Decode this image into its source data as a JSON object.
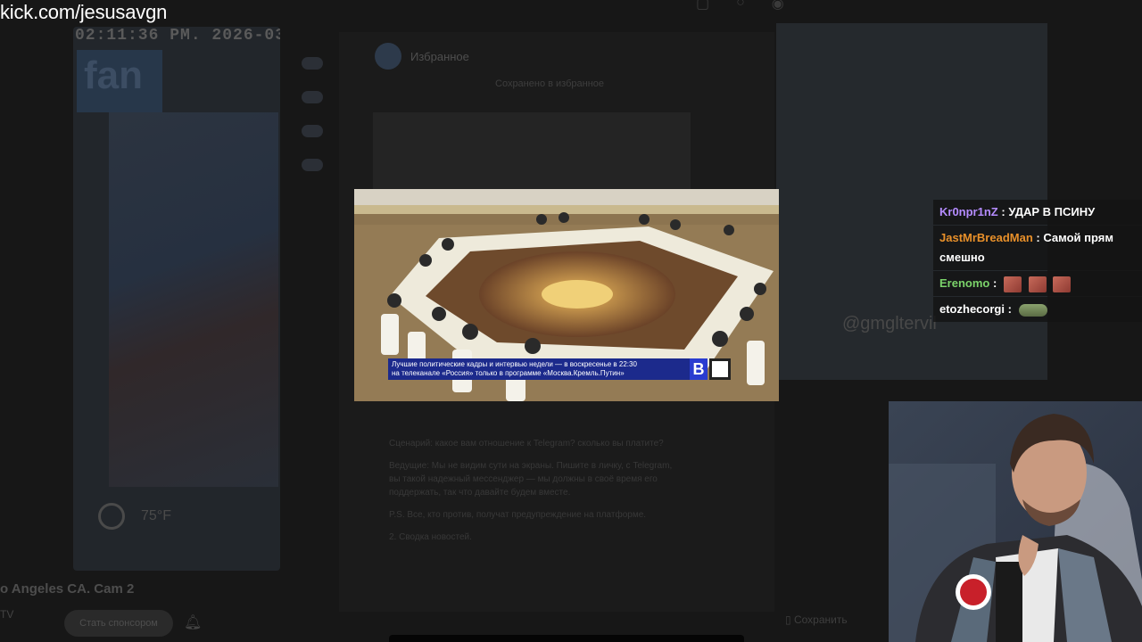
{
  "stream": {
    "channel_url": "kick.com/jesusavgn"
  },
  "background": {
    "clock": "02:11:36 PM.  2026-03-",
    "logo_text": "fan",
    "temperature": "75°F",
    "cam_title": "o Angeles CA. Cam 2",
    "cam_channel": "TV",
    "subscribe_label": "Стать спонсором",
    "messenger_title": "Избранное",
    "pinned_label": "Сохранено в избранное",
    "save_label": "Сохранить",
    "watermark": "@gmgltervil",
    "article_paragraphs": [
      "Сценарий: какое вам отношение к Telegram? сколько вы платите?",
      "Ведущие: Мы не видим сути на экраны. Пишите в личку, с Telegram, вы такой надежный мессенджер — мы должны в своё время его поддержать, так что давайте будем вместе.",
      "P.S. Все, кто против, получат предупреждение на платформе.",
      "2. Сводка новостей."
    ]
  },
  "video": {
    "ticker_line1": "Лучшие политические кадры и интервью недели — в воскресенье в 22:30",
    "ticker_line2": "на телеканале «Россия» только в программе «Москва.Кремль.Путин»",
    "channel_logo": "В",
    "colors": {
      "ticker": "#1c2a8c",
      "table": "#f1ecd8",
      "floor": "#7a5a3a"
    }
  },
  "chat": {
    "messages": [
      {
        "user": "Kr0npr1nZ",
        "user_color": "#b58cff",
        "text": "УДАР В ПСИНУ",
        "emotes": []
      },
      {
        "user": "JastMrBreadMan",
        "user_color": "#e8902a",
        "text": "Самой прям смешно",
        "emotes": []
      },
      {
        "user": "Erenomo",
        "user_color": "#7bd36a",
        "text": "",
        "emotes": [
          "red",
          "red",
          "red"
        ]
      },
      {
        "user": "etozhecorgi",
        "user_color": "#ffffff",
        "text": "",
        "emotes": [
          "frog"
        ]
      }
    ]
  }
}
